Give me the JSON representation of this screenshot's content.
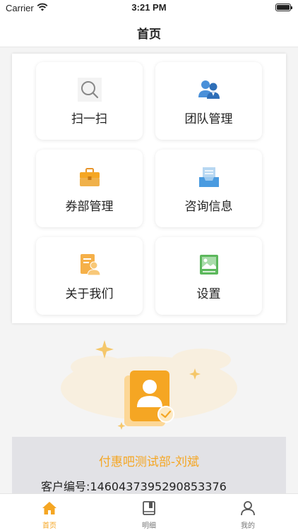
{
  "status_bar": {
    "carrier": "Carrier",
    "time": "3:21 PM"
  },
  "nav": {
    "title": "首页"
  },
  "grid": {
    "items": [
      {
        "label": "扫一扫",
        "icon": "scan-icon"
      },
      {
        "label": "团队管理",
        "icon": "team-icon"
      },
      {
        "label": "券部管理",
        "icon": "briefcase-icon"
      },
      {
        "label": "咨询信息",
        "icon": "inbox-icon"
      },
      {
        "label": "关于我们",
        "icon": "about-profile-icon"
      },
      {
        "label": "设置",
        "icon": "settings-image-icon"
      }
    ]
  },
  "profile": {
    "name": "付惠吧测试部-刘斌",
    "customer_id": "客户编号:1460437395290853376"
  },
  "tab_bar": {
    "tabs": [
      {
        "label": "首页",
        "icon": "home-icon",
        "active": true
      },
      {
        "label": "明细",
        "icon": "detail-book-icon",
        "active": false
      },
      {
        "label": "我的",
        "icon": "user-icon",
        "active": false
      }
    ]
  },
  "colors": {
    "accent": "#f5a623",
    "blue": "#3d8bd8",
    "green": "#5cb85c",
    "card_bg": "#e2e2e6"
  }
}
